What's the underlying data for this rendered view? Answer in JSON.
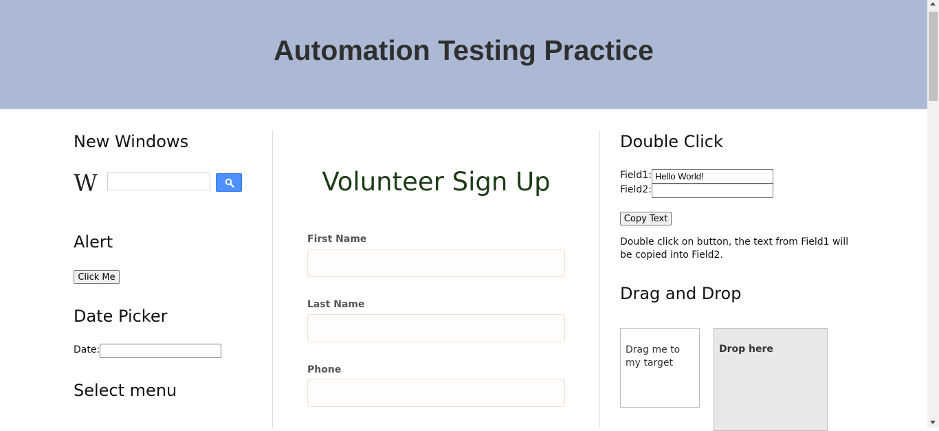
{
  "header": {
    "title": "Automation Testing Practice"
  },
  "left": {
    "new_windows": {
      "heading": "New Windows",
      "logo_text": "W",
      "search_value": "",
      "search_button_icon": "search-icon"
    },
    "alert": {
      "heading": "Alert",
      "button_label": "Click Me"
    },
    "date_picker": {
      "heading": "Date Picker",
      "label": "Date:",
      "value": ""
    },
    "select_menu": {
      "heading": "Select menu"
    }
  },
  "middle": {
    "title": "Volunteer Sign Up",
    "fields": [
      {
        "label": "First Name",
        "value": ""
      },
      {
        "label": "Last Name",
        "value": ""
      },
      {
        "label": "Phone",
        "value": ""
      }
    ]
  },
  "right": {
    "double_click": {
      "heading": "Double Click",
      "field1_label": "Field1:",
      "field1_value": "Hello World!",
      "field2_label": "Field2:",
      "field2_value": "",
      "button_label": "Copy Text",
      "description": "Double click on button, the text from Field1 will be copied into Field2."
    },
    "drag_drop": {
      "heading": "Drag and Drop",
      "draggable_text": "Drag me to my target",
      "drop_text": "Drop here"
    }
  },
  "colors": {
    "header_bg": "#acb9d5",
    "signup_title": "#1c3b16",
    "wiki_button": "#4d90fe"
  }
}
